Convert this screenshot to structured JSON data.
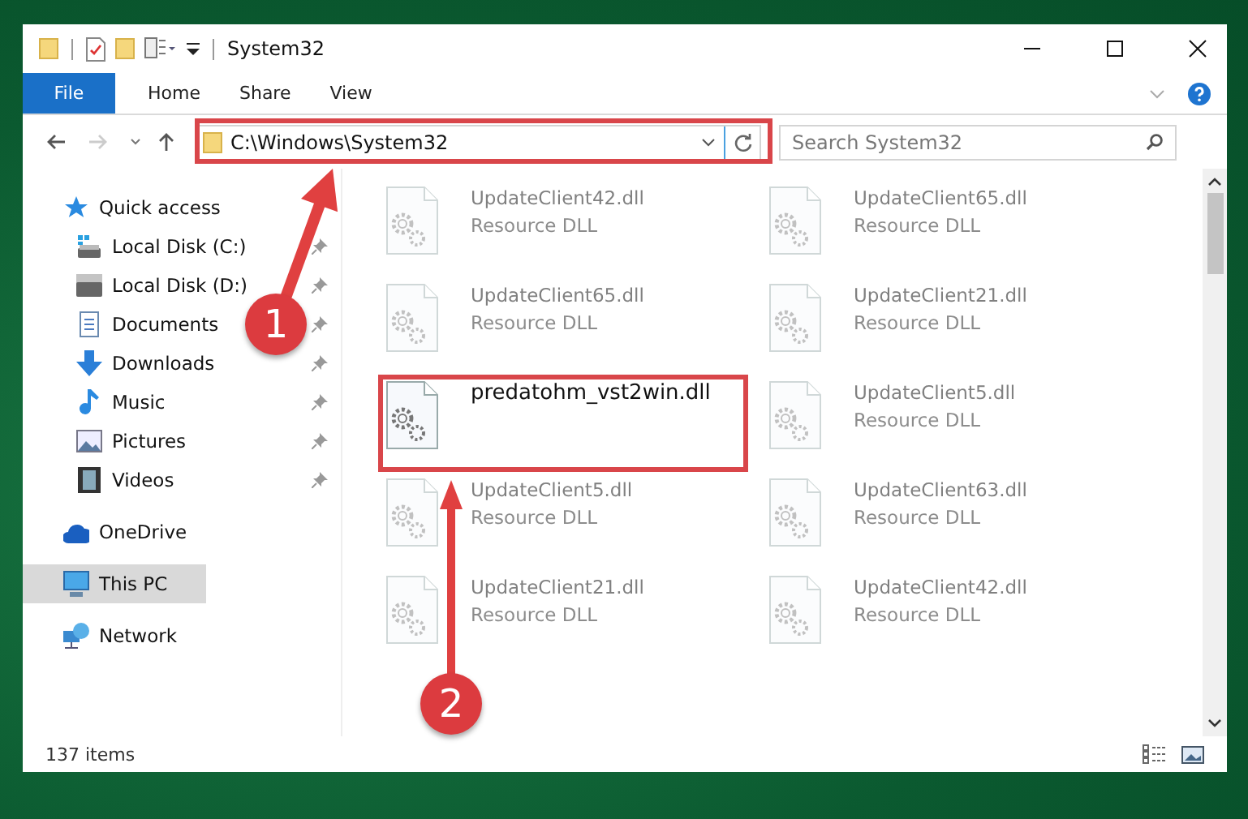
{
  "window": {
    "title": "System32"
  },
  "ribbon_tabs": [
    {
      "label": "File",
      "selected": true
    },
    {
      "label": "Home",
      "selected": false
    },
    {
      "label": "Share",
      "selected": false
    },
    {
      "label": "View",
      "selected": false
    }
  ],
  "address": {
    "path": "C:\\Windows\\System32"
  },
  "search": {
    "placeholder": "Search System32"
  },
  "sidebar": {
    "items": [
      {
        "label": "Quick access",
        "kind": "star",
        "selected": false,
        "children": [
          {
            "label": "Local Disk (C:)",
            "kind": "system-drive",
            "pinned": true,
            "selected": false
          },
          {
            "label": "Local Disk (D:)",
            "kind": "drive",
            "pinned": true,
            "selected": false
          },
          {
            "label": "Documents",
            "kind": "documents",
            "pinned": true,
            "selected": false
          },
          {
            "label": "Downloads",
            "kind": "downloads",
            "pinned": true,
            "selected": false
          },
          {
            "label": "Music",
            "kind": "music",
            "pinned": true,
            "selected": false
          },
          {
            "label": "Pictures",
            "kind": "pictures",
            "pinned": true,
            "selected": false
          },
          {
            "label": "Videos",
            "kind": "videos",
            "pinned": true,
            "selected": false
          }
        ]
      },
      {
        "label": "OneDrive",
        "kind": "cloud",
        "selected": false
      },
      {
        "label": "This PC",
        "kind": "pc",
        "selected": true
      },
      {
        "label": "Network",
        "kind": "network",
        "selected": false
      }
    ]
  },
  "files": [
    {
      "name": "UpdateClient42.dll",
      "type": "Resource DLL",
      "dimmed": true
    },
    {
      "name": "UpdateClient65.dll",
      "type": "Resource DLL",
      "dimmed": true
    },
    {
      "name": "UpdateClient65.dll",
      "type": "Resource DLL",
      "dimmed": true
    },
    {
      "name": "UpdateClient21.dll",
      "type": "Resource DLL",
      "dimmed": true
    },
    {
      "name": "predatohm_vst2win.dll",
      "dimmed": false
    },
    {
      "name": "UpdateClient5.dll",
      "type": "Resource DLL",
      "dimmed": true
    },
    {
      "name": "UpdateClient5.dll",
      "type": "Resource DLL",
      "dimmed": true
    },
    {
      "name": "UpdateClient63.dll",
      "type": "Resource DLL",
      "dimmed": true
    },
    {
      "name": "UpdateClient21.dll",
      "type": "Resource DLL",
      "dimmed": true
    },
    {
      "name": "UpdateClient42.dll",
      "type": "Resource DLL",
      "dimmed": true
    }
  ],
  "status_bar": {
    "item_count": "137 items"
  },
  "callouts": [
    {
      "number": "1"
    },
    {
      "number": "2"
    }
  ]
}
